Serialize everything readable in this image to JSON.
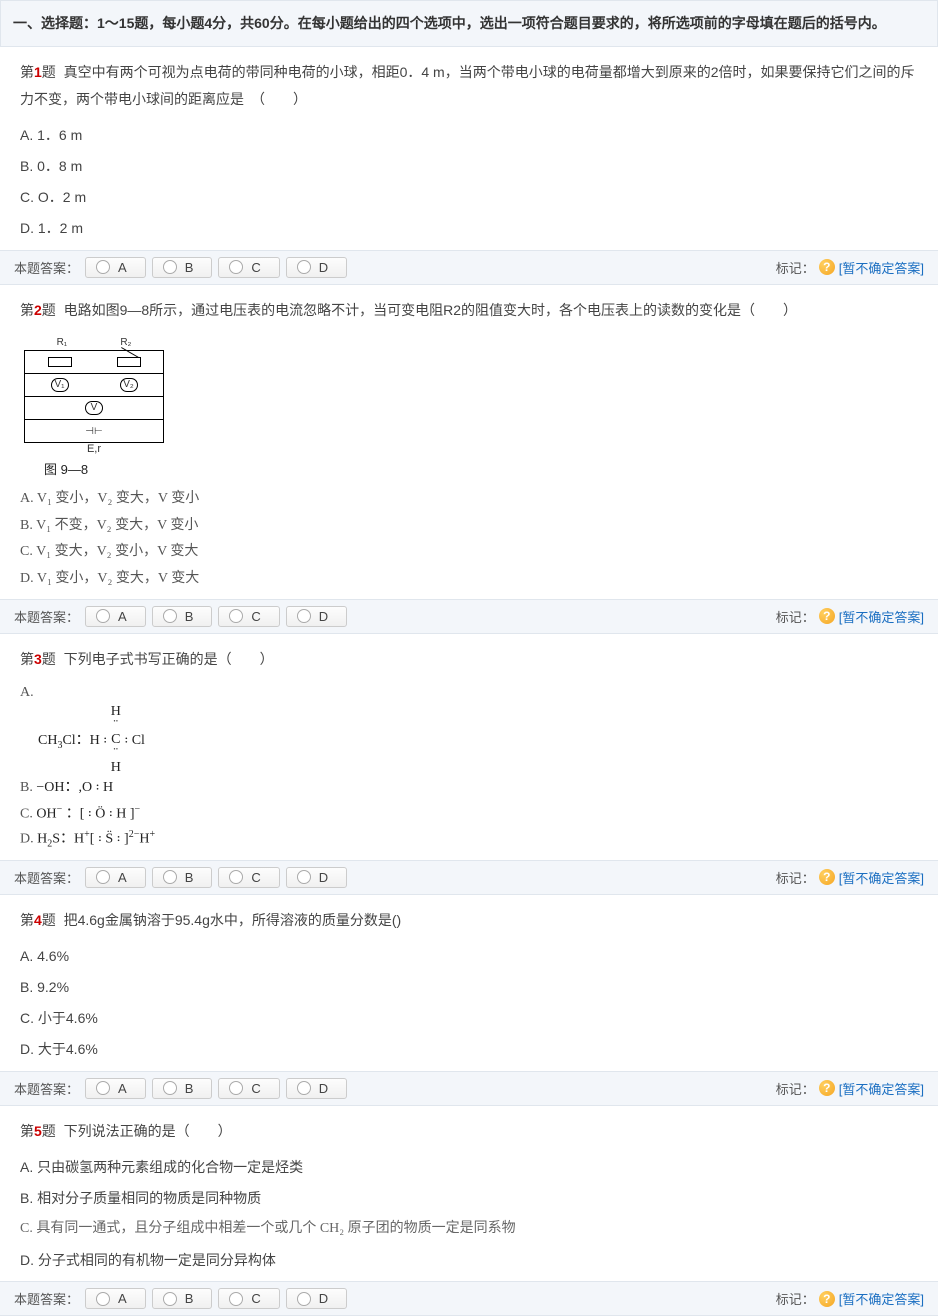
{
  "section_header": "一、选择题：1～15题，每小题4分，共60分。在每小题给出的四个选项中，选出一项符合题目要求的，将所选项前的字母填在题后的括号内。",
  "answer_bar": {
    "label": "本题答案：",
    "choices": [
      "A",
      "B",
      "C",
      "D"
    ],
    "mark_label": "标记：",
    "mark_link": "[暂不确定答案]"
  },
  "questions": [
    {
      "num": "1",
      "prefix": "第",
      "suffix": "题",
      "stem": "真空中有两个可视为点电荷的带同种电荷的小球，相距0．4 m，当两个带电小球的电荷量都增大到原来的2倍时，如果要保持它们之间的斥力不变，两个带电小球间的距离应是　（　　）",
      "options": [
        "A. 1．6 m",
        "B. 0．8 m",
        "C. O．2 m",
        "D. 1．2 m"
      ]
    },
    {
      "num": "2",
      "prefix": "第",
      "suffix": "题",
      "stem": "电路如图9—8所示，通过电压表的电流忽略不计，当可变电阻R2的阻值变大时，各个电压表上的读数的变化是（　　）",
      "figure_caption": "图 9—8",
      "options": [
        "A.  V₁ 变小，V₂ 变大，V 变小",
        "B.  V₁ 不变，V₂ 变大，V 变小",
        "C.  V₁ 变大，V₂ 变小，V 变大",
        "D.  V₁ 变小，V₂ 变大，V 变大"
      ]
    },
    {
      "num": "3",
      "prefix": "第",
      "suffix": "题",
      "stem": "下列电子式书写正确的是（　　）",
      "options": [
        "A.  CH₃Cl：H ꞉ C ꞉ Cl （上下各一个H）",
        "B.  −OH：,O ꞉ H",
        "C.  OH⁻ ：[ ꞉ Ö ꞉ H ]⁻",
        "D.  H₂S：H⁺[ ꞉ S̈ ꞉ ]²⁻H⁺"
      ]
    },
    {
      "num": "4",
      "prefix": "第",
      "suffix": "题",
      "stem": "把4.6g金属钠溶于95.4g水中，所得溶液的质量分数是()",
      "options": [
        "A. 4.6%",
        "B. 9.2%",
        "C. 小于4.6%",
        "D. 大于4.6%"
      ]
    },
    {
      "num": "5",
      "prefix": "第",
      "suffix": "题",
      "stem": "下列说法正确的是（　　）",
      "options": [
        "A. 只由碳氢两种元素组成的化合物一定是烃类",
        "B. 相对分子质量相同的物质是同种物质",
        "C. 具有同一通式，且分子组成中相差一个或几个 CH₂ 原子团的物质一定是同系物",
        "D. 分子式相同的有机物一定是同分异构体"
      ]
    }
  ]
}
